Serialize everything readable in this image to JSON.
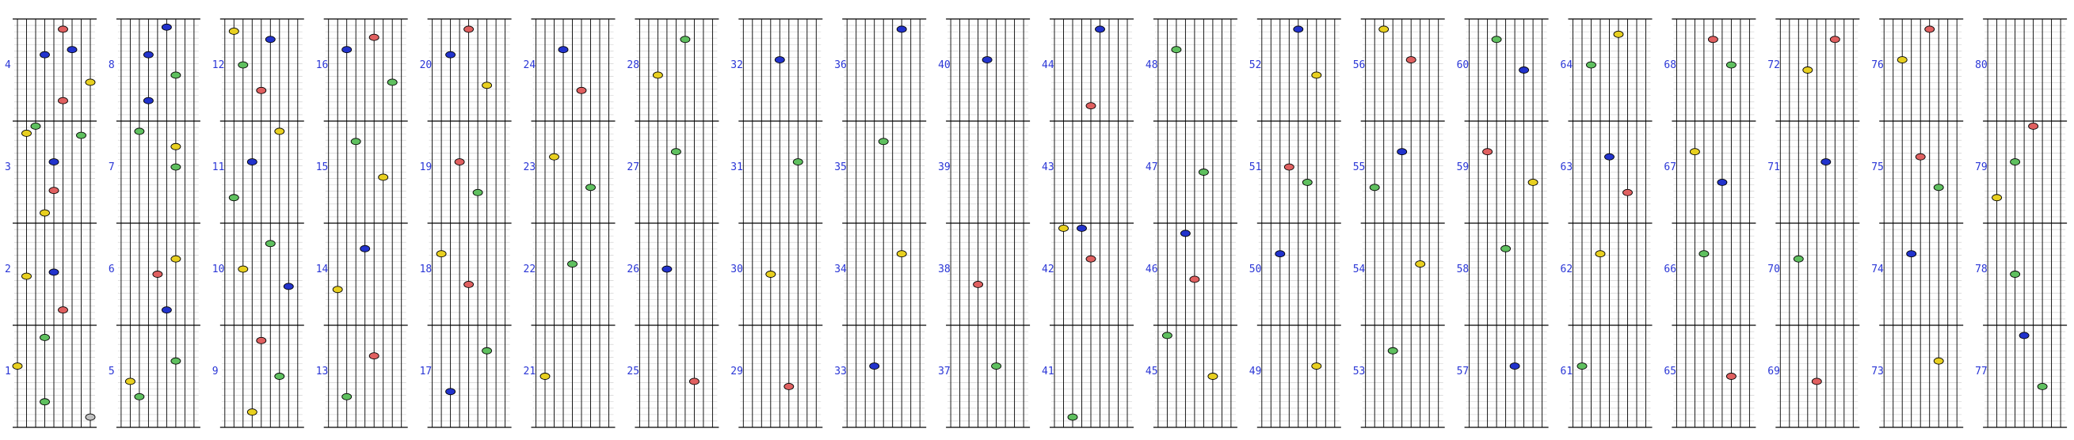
{
  "colors": {
    "background": "#ffffff",
    "string_line": "#000000",
    "grid_line": "#c8c8c8",
    "measure_line": "#000000",
    "measure_number": "#2a36d6",
    "note_red": "#e06060",
    "note_blue": "#2233cc",
    "note_green": "#5fc05f",
    "note_yellow": "#e8d020",
    "note_gray": "#c0c0c0"
  },
  "score": {
    "columns": 20,
    "measures_per_column": 4,
    "measure_numbers": [
      "4",
      "3",
      "2",
      "1",
      "8",
      "7",
      "6",
      "5",
      "12",
      "11",
      "10",
      "9",
      "16",
      "15",
      "14",
      "13",
      "20",
      "19",
      "18",
      "17",
      "24",
      "23",
      "22",
      "21",
      "28",
      "27",
      "26",
      "25",
      "32",
      "31",
      "30",
      "29",
      "36",
      "35",
      "34",
      "33",
      "40",
      "39",
      "38",
      "37",
      "44",
      "43",
      "42",
      "41",
      "48",
      "47",
      "46",
      "45",
      "52",
      "51",
      "50",
      "49",
      "56",
      "55",
      "54",
      "53",
      "60",
      "59",
      "58",
      "57",
      "64",
      "63",
      "62",
      "61",
      "68",
      "67",
      "66",
      "65",
      "72",
      "71",
      "70",
      "69",
      "76",
      "75",
      "74",
      "73",
      "80",
      "79",
      "78",
      "77"
    ],
    "notes": [
      {
        "col": 0,
        "m": 0,
        "pos": 0.1,
        "lane": 5,
        "color": "note_red"
      },
      {
        "col": 0,
        "m": 0,
        "pos": 0.35,
        "lane": 3,
        "color": "note_blue"
      },
      {
        "col": 0,
        "m": 0,
        "pos": 0.3,
        "lane": 6,
        "color": "note_blue"
      },
      {
        "col": 0,
        "m": 0,
        "pos": 0.62,
        "lane": 8,
        "color": "note_yellow"
      },
      {
        "col": 0,
        "m": 0,
        "pos": 0.8,
        "lane": 5,
        "color": "note_red"
      },
      {
        "col": 0,
        "m": 1,
        "pos": 0.05,
        "lane": 2,
        "color": "note_green"
      },
      {
        "col": 0,
        "m": 1,
        "pos": 0.12,
        "lane": 1,
        "color": "note_yellow"
      },
      {
        "col": 0,
        "m": 1,
        "pos": 0.14,
        "lane": 7,
        "color": "note_green"
      },
      {
        "col": 0,
        "m": 1,
        "pos": 0.4,
        "lane": 4,
        "color": "note_blue"
      },
      {
        "col": 0,
        "m": 1,
        "pos": 0.68,
        "lane": 4,
        "color": "note_red"
      },
      {
        "col": 0,
        "m": 1,
        "pos": 0.9,
        "lane": 3,
        "color": "note_yellow"
      },
      {
        "col": 0,
        "m": 2,
        "pos": 0.48,
        "lane": 4,
        "color": "note_blue"
      },
      {
        "col": 0,
        "m": 2,
        "pos": 0.52,
        "lane": 1,
        "color": "note_yellow"
      },
      {
        "col": 0,
        "m": 2,
        "pos": 0.85,
        "lane": 5,
        "color": "note_red"
      },
      {
        "col": 0,
        "m": 3,
        "pos": 0.12,
        "lane": 3,
        "color": "note_green"
      },
      {
        "col": 0,
        "m": 3,
        "pos": 0.4,
        "lane": 0,
        "color": "note_yellow"
      },
      {
        "col": 0,
        "m": 3,
        "pos": 0.75,
        "lane": 3,
        "color": "note_green"
      },
      {
        "col": 0,
        "m": 3,
        "pos": 0.9,
        "lane": 8,
        "color": "note_gray"
      },
      {
        "col": 1,
        "m": 0,
        "pos": 0.08,
        "lane": 5,
        "color": "note_blue"
      },
      {
        "col": 1,
        "m": 0,
        "pos": 0.35,
        "lane": 3,
        "color": "note_blue"
      },
      {
        "col": 1,
        "m": 0,
        "pos": 0.55,
        "lane": 6,
        "color": "note_green"
      },
      {
        "col": 1,
        "m": 0,
        "pos": 0.8,
        "lane": 3,
        "color": "note_blue"
      },
      {
        "col": 1,
        "m": 1,
        "pos": 0.1,
        "lane": 2,
        "color": "note_green"
      },
      {
        "col": 1,
        "m": 1,
        "pos": 0.25,
        "lane": 6,
        "color": "note_yellow"
      },
      {
        "col": 1,
        "m": 1,
        "pos": 0.45,
        "lane": 6,
        "color": "note_green"
      },
      {
        "col": 1,
        "m": 2,
        "pos": 0.35,
        "lane": 6,
        "color": "note_yellow"
      },
      {
        "col": 1,
        "m": 2,
        "pos": 0.5,
        "lane": 4,
        "color": "note_red"
      },
      {
        "col": 1,
        "m": 2,
        "pos": 0.85,
        "lane": 5,
        "color": "note_blue"
      },
      {
        "col": 1,
        "m": 3,
        "pos": 0.35,
        "lane": 6,
        "color": "note_green"
      },
      {
        "col": 1,
        "m": 3,
        "pos": 0.55,
        "lane": 1,
        "color": "note_yellow"
      },
      {
        "col": 1,
        "m": 3,
        "pos": 0.7,
        "lane": 2,
        "color": "note_green"
      },
      {
        "col": 2,
        "m": 0,
        "pos": 0.12,
        "lane": 1,
        "color": "note_yellow"
      },
      {
        "col": 2,
        "m": 0,
        "pos": 0.2,
        "lane": 5,
        "color": "note_blue"
      },
      {
        "col": 2,
        "m": 0,
        "pos": 0.45,
        "lane": 2,
        "color": "note_green"
      },
      {
        "col": 2,
        "m": 0,
        "pos": 0.7,
        "lane": 4,
        "color": "note_red"
      },
      {
        "col": 2,
        "m": 1,
        "pos": 0.1,
        "lane": 6,
        "color": "note_yellow"
      },
      {
        "col": 2,
        "m": 1,
        "pos": 0.4,
        "lane": 3,
        "color": "note_blue"
      },
      {
        "col": 2,
        "m": 1,
        "pos": 0.75,
        "lane": 1,
        "color": "note_green"
      },
      {
        "col": 2,
        "m": 2,
        "pos": 0.2,
        "lane": 5,
        "color": "note_green"
      },
      {
        "col": 2,
        "m": 2,
        "pos": 0.45,
        "lane": 2,
        "color": "note_yellow"
      },
      {
        "col": 2,
        "m": 2,
        "pos": 0.62,
        "lane": 7,
        "color": "note_blue"
      },
      {
        "col": 2,
        "m": 3,
        "pos": 0.15,
        "lane": 4,
        "color": "note_red"
      },
      {
        "col": 2,
        "m": 3,
        "pos": 0.5,
        "lane": 6,
        "color": "note_green"
      },
      {
        "col": 2,
        "m": 3,
        "pos": 0.85,
        "lane": 3,
        "color": "note_yellow"
      },
      {
        "col": 3,
        "m": 0,
        "pos": 0.18,
        "lane": 5,
        "color": "note_red"
      },
      {
        "col": 3,
        "m": 0,
        "pos": 0.3,
        "lane": 2,
        "color": "note_blue"
      },
      {
        "col": 3,
        "m": 0,
        "pos": 0.62,
        "lane": 7,
        "color": "note_green"
      },
      {
        "col": 3,
        "m": 1,
        "pos": 0.2,
        "lane": 3,
        "color": "note_green"
      },
      {
        "col": 3,
        "m": 1,
        "pos": 0.55,
        "lane": 6,
        "color": "note_yellow"
      },
      {
        "col": 3,
        "m": 2,
        "pos": 0.25,
        "lane": 4,
        "color": "note_blue"
      },
      {
        "col": 3,
        "m": 2,
        "pos": 0.65,
        "lane": 1,
        "color": "note_yellow"
      },
      {
        "col": 3,
        "m": 3,
        "pos": 0.3,
        "lane": 5,
        "color": "note_red"
      },
      {
        "col": 3,
        "m": 3,
        "pos": 0.7,
        "lane": 2,
        "color": "note_green"
      },
      {
        "col": 4,
        "m": 0,
        "pos": 0.1,
        "lane": 4,
        "color": "note_red"
      },
      {
        "col": 4,
        "m": 0,
        "pos": 0.35,
        "lane": 2,
        "color": "note_blue"
      },
      {
        "col": 4,
        "m": 0,
        "pos": 0.65,
        "lane": 6,
        "color": "note_yellow"
      },
      {
        "col": 4,
        "m": 1,
        "pos": 0.4,
        "lane": 3,
        "color": "note_red"
      },
      {
        "col": 4,
        "m": 1,
        "pos": 0.7,
        "lane": 5,
        "color": "note_green"
      },
      {
        "col": 4,
        "m": 2,
        "pos": 0.3,
        "lane": 1,
        "color": "note_yellow"
      },
      {
        "col": 4,
        "m": 2,
        "pos": 0.6,
        "lane": 4,
        "color": "note_red"
      },
      {
        "col": 4,
        "m": 3,
        "pos": 0.25,
        "lane": 6,
        "color": "note_green"
      },
      {
        "col": 4,
        "m": 3,
        "pos": 0.65,
        "lane": 2,
        "color": "note_blue"
      },
      {
        "col": 5,
        "m": 0,
        "pos": 0.3,
        "lane": 3,
        "color": "note_blue"
      },
      {
        "col": 5,
        "m": 0,
        "pos": 0.7,
        "lane": 5,
        "color": "note_red"
      },
      {
        "col": 5,
        "m": 1,
        "pos": 0.35,
        "lane": 2,
        "color": "note_yellow"
      },
      {
        "col": 5,
        "m": 1,
        "pos": 0.65,
        "lane": 6,
        "color": "note_green"
      },
      {
        "col": 5,
        "m": 2,
        "pos": 0.4,
        "lane": 4,
        "color": "note_green"
      },
      {
        "col": 5,
        "m": 3,
        "pos": 0.5,
        "lane": 1,
        "color": "note_yellow"
      },
      {
        "col": 6,
        "m": 0,
        "pos": 0.2,
        "lane": 5,
        "color": "note_green"
      },
      {
        "col": 6,
        "m": 0,
        "pos": 0.55,
        "lane": 2,
        "color": "note_yellow"
      },
      {
        "col": 6,
        "m": 1,
        "pos": 0.3,
        "lane": 4,
        "color": "note_green"
      },
      {
        "col": 6,
        "m": 2,
        "pos": 0.45,
        "lane": 3,
        "color": "note_blue"
      },
      {
        "col": 6,
        "m": 3,
        "pos": 0.55,
        "lane": 6,
        "color": "note_red"
      },
      {
        "col": 7,
        "m": 0,
        "pos": 0.4,
        "lane": 4,
        "color": "note_blue"
      },
      {
        "col": 7,
        "m": 1,
        "pos": 0.4,
        "lane": 6,
        "color": "note_green"
      },
      {
        "col": 7,
        "m": 2,
        "pos": 0.5,
        "lane": 3,
        "color": "note_yellow"
      },
      {
        "col": 7,
        "m": 3,
        "pos": 0.6,
        "lane": 5,
        "color": "note_red"
      },
      {
        "col": 8,
        "m": 0,
        "pos": 0.1,
        "lane": 6,
        "color": "note_blue"
      },
      {
        "col": 8,
        "m": 1,
        "pos": 0.2,
        "lane": 4,
        "color": "note_green"
      },
      {
        "col": 8,
        "m": 2,
        "pos": 0.3,
        "lane": 6,
        "color": "note_yellow"
      },
      {
        "col": 8,
        "m": 3,
        "pos": 0.4,
        "lane": 3,
        "color": "note_blue"
      },
      {
        "col": 9,
        "m": 0,
        "pos": 0.4,
        "lane": 4,
        "color": "note_blue"
      },
      {
        "col": 9,
        "m": 2,
        "pos": 0.6,
        "lane": 3,
        "color": "note_red"
      },
      {
        "col": 9,
        "m": 3,
        "pos": 0.4,
        "lane": 5,
        "color": "note_green"
      },
      {
        "col": 10,
        "m": 0,
        "pos": 0.1,
        "lane": 5,
        "color": "note_blue"
      },
      {
        "col": 10,
        "m": 0,
        "pos": 0.85,
        "lane": 4,
        "color": "note_red"
      },
      {
        "col": 10,
        "m": 2,
        "pos": 0.05,
        "lane": 1,
        "color": "note_yellow"
      },
      {
        "col": 10,
        "m": 2,
        "pos": 0.05,
        "lane": 3,
        "color": "note_blue"
      },
      {
        "col": 10,
        "m": 2,
        "pos": 0.35,
        "lane": 4,
        "color": "note_red"
      },
      {
        "col": 10,
        "m": 3,
        "pos": 0.9,
        "lane": 2,
        "color": "note_green"
      },
      {
        "col": 11,
        "m": 0,
        "pos": 0.3,
        "lane": 2,
        "color": "note_green"
      },
      {
        "col": 11,
        "m": 1,
        "pos": 0.5,
        "lane": 5,
        "color": "note_green"
      },
      {
        "col": 11,
        "m": 2,
        "pos": 0.1,
        "lane": 3,
        "color": "note_blue"
      },
      {
        "col": 11,
        "m": 2,
        "pos": 0.55,
        "lane": 4,
        "color": "note_red"
      },
      {
        "col": 11,
        "m": 3,
        "pos": 0.1,
        "lane": 1,
        "color": "note_green"
      },
      {
        "col": 11,
        "m": 3,
        "pos": 0.5,
        "lane": 6,
        "color": "note_yellow"
      },
      {
        "col": 12,
        "m": 0,
        "pos": 0.1,
        "lane": 4,
        "color": "note_blue"
      },
      {
        "col": 12,
        "m": 0,
        "pos": 0.55,
        "lane": 6,
        "color": "note_yellow"
      },
      {
        "col": 12,
        "m": 1,
        "pos": 0.45,
        "lane": 3,
        "color": "note_red"
      },
      {
        "col": 12,
        "m": 1,
        "pos": 0.6,
        "lane": 5,
        "color": "note_green"
      },
      {
        "col": 12,
        "m": 2,
        "pos": 0.3,
        "lane": 2,
        "color": "note_blue"
      },
      {
        "col": 12,
        "m": 3,
        "pos": 0.4,
        "lane": 6,
        "color": "note_yellow"
      },
      {
        "col": 13,
        "m": 0,
        "pos": 0.1,
        "lane": 2,
        "color": "note_yellow"
      },
      {
        "col": 13,
        "m": 0,
        "pos": 0.4,
        "lane": 5,
        "color": "note_red"
      },
      {
        "col": 13,
        "m": 1,
        "pos": 0.3,
        "lane": 4,
        "color": "note_blue"
      },
      {
        "col": 13,
        "m": 1,
        "pos": 0.65,
        "lane": 1,
        "color": "note_green"
      },
      {
        "col": 13,
        "m": 2,
        "pos": 0.4,
        "lane": 6,
        "color": "note_yellow"
      },
      {
        "col": 13,
        "m": 3,
        "pos": 0.25,
        "lane": 3,
        "color": "note_green"
      },
      {
        "col": 14,
        "m": 0,
        "pos": 0.2,
        "lane": 3,
        "color": "note_green"
      },
      {
        "col": 14,
        "m": 0,
        "pos": 0.5,
        "lane": 6,
        "color": "note_blue"
      },
      {
        "col": 14,
        "m": 1,
        "pos": 0.3,
        "lane": 2,
        "color": "note_red"
      },
      {
        "col": 14,
        "m": 1,
        "pos": 0.6,
        "lane": 7,
        "color": "note_yellow"
      },
      {
        "col": 14,
        "m": 2,
        "pos": 0.25,
        "lane": 4,
        "color": "note_green"
      },
      {
        "col": 14,
        "m": 3,
        "pos": 0.4,
        "lane": 5,
        "color": "note_blue"
      },
      {
        "col": 15,
        "m": 0,
        "pos": 0.15,
        "lane": 5,
        "color": "note_yellow"
      },
      {
        "col": 15,
        "m": 0,
        "pos": 0.45,
        "lane": 2,
        "color": "note_green"
      },
      {
        "col": 15,
        "m": 1,
        "pos": 0.35,
        "lane": 4,
        "color": "note_blue"
      },
      {
        "col": 15,
        "m": 1,
        "pos": 0.7,
        "lane": 6,
        "color": "note_red"
      },
      {
        "col": 15,
        "m": 2,
        "pos": 0.3,
        "lane": 3,
        "color": "note_yellow"
      },
      {
        "col": 15,
        "m": 3,
        "pos": 0.4,
        "lane": 1,
        "color": "note_green"
      },
      {
        "col": 16,
        "m": 0,
        "pos": 0.2,
        "lane": 4,
        "color": "note_red"
      },
      {
        "col": 16,
        "m": 0,
        "pos": 0.45,
        "lane": 6,
        "color": "note_green"
      },
      {
        "col": 16,
        "m": 1,
        "pos": 0.3,
        "lane": 2,
        "color": "note_yellow"
      },
      {
        "col": 16,
        "m": 1,
        "pos": 0.6,
        "lane": 5,
        "color": "note_blue"
      },
      {
        "col": 16,
        "m": 2,
        "pos": 0.3,
        "lane": 3,
        "color": "note_green"
      },
      {
        "col": 16,
        "m": 3,
        "pos": 0.5,
        "lane": 6,
        "color": "note_red"
      },
      {
        "col": 17,
        "m": 0,
        "pos": 0.2,
        "lane": 6,
        "color": "note_red"
      },
      {
        "col": 17,
        "m": 0,
        "pos": 0.5,
        "lane": 3,
        "color": "note_yellow"
      },
      {
        "col": 17,
        "m": 1,
        "pos": 0.4,
        "lane": 5,
        "color": "note_blue"
      },
      {
        "col": 17,
        "m": 2,
        "pos": 0.35,
        "lane": 2,
        "color": "note_green"
      },
      {
        "col": 17,
        "m": 3,
        "pos": 0.55,
        "lane": 4,
        "color": "note_red"
      },
      {
        "col": 18,
        "m": 0,
        "pos": 0.1,
        "lane": 5,
        "color": "note_red"
      },
      {
        "col": 18,
        "m": 0,
        "pos": 0.4,
        "lane": 2,
        "color": "note_yellow"
      },
      {
        "col": 18,
        "m": 1,
        "pos": 0.35,
        "lane": 4,
        "color": "note_red"
      },
      {
        "col": 18,
        "m": 1,
        "pos": 0.65,
        "lane": 6,
        "color": "note_green"
      },
      {
        "col": 18,
        "m": 2,
        "pos": 0.3,
        "lane": 3,
        "color": "note_blue"
      },
      {
        "col": 18,
        "m": 3,
        "pos": 0.35,
        "lane": 6,
        "color": "note_yellow"
      },
      {
        "col": 19,
        "m": 1,
        "pos": 0.05,
        "lane": 5,
        "color": "note_red"
      },
      {
        "col": 19,
        "m": 1,
        "pos": 0.4,
        "lane": 3,
        "color": "note_green"
      },
      {
        "col": 19,
        "m": 1,
        "pos": 0.75,
        "lane": 1,
        "color": "note_yellow"
      },
      {
        "col": 19,
        "m": 2,
        "pos": 0.5,
        "lane": 3,
        "color": "note_green"
      },
      {
        "col": 19,
        "m": 3,
        "pos": 0.1,
        "lane": 4,
        "color": "note_blue"
      },
      {
        "col": 19,
        "m": 3,
        "pos": 0.6,
        "lane": 6,
        "color": "note_green"
      }
    ]
  }
}
